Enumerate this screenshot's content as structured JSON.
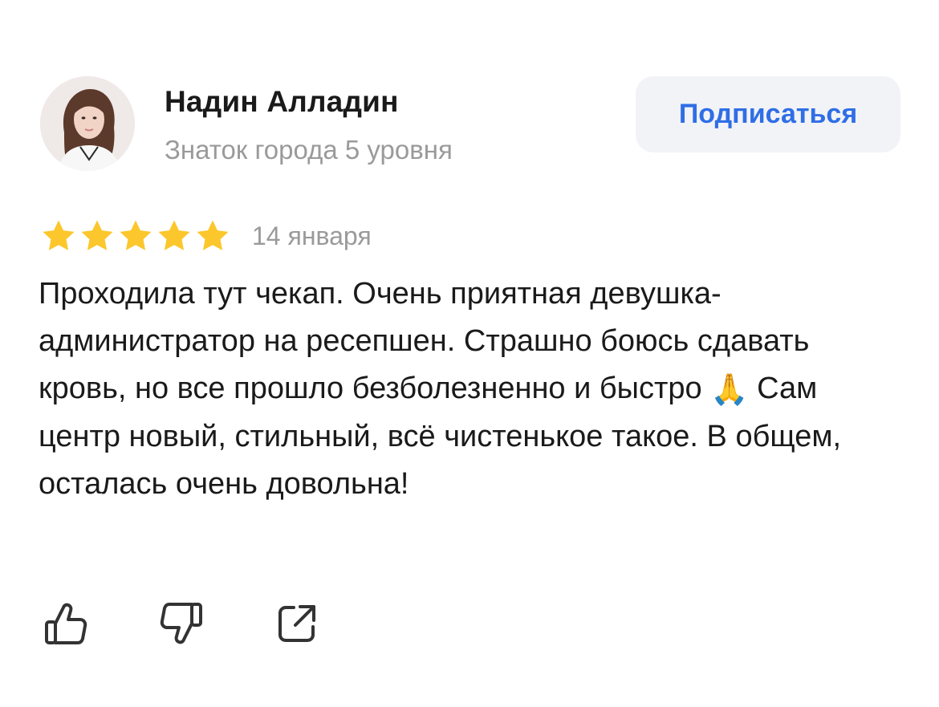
{
  "author": {
    "name": "Надин Алладин",
    "level": "Знаток города 5 уровня"
  },
  "subscribe_label": "Подписаться",
  "review": {
    "rating": 5,
    "max_rating": 5,
    "date": "14 января",
    "text_parts": {
      "before_emoji": "Проходила тут чекап. Очень приятная девушка-администратор на ресепшен. Страшно боюсь сдавать кровь, но все прошло безболезненно и быстро ",
      "emoji": "🙏",
      "after_emoji": " Сам центр новый, стильный, всё чистенькое такое. В общем, осталась очень довольна!"
    }
  },
  "actions": {
    "like_icon": "thumbs-up-icon",
    "dislike_icon": "thumbs-down-icon",
    "share_icon": "share-icon"
  },
  "colors": {
    "star": "#fcc72c",
    "accent": "#2f6ee5",
    "secondary_text": "#9a9a9a",
    "button_bg": "#f2f3f7"
  }
}
